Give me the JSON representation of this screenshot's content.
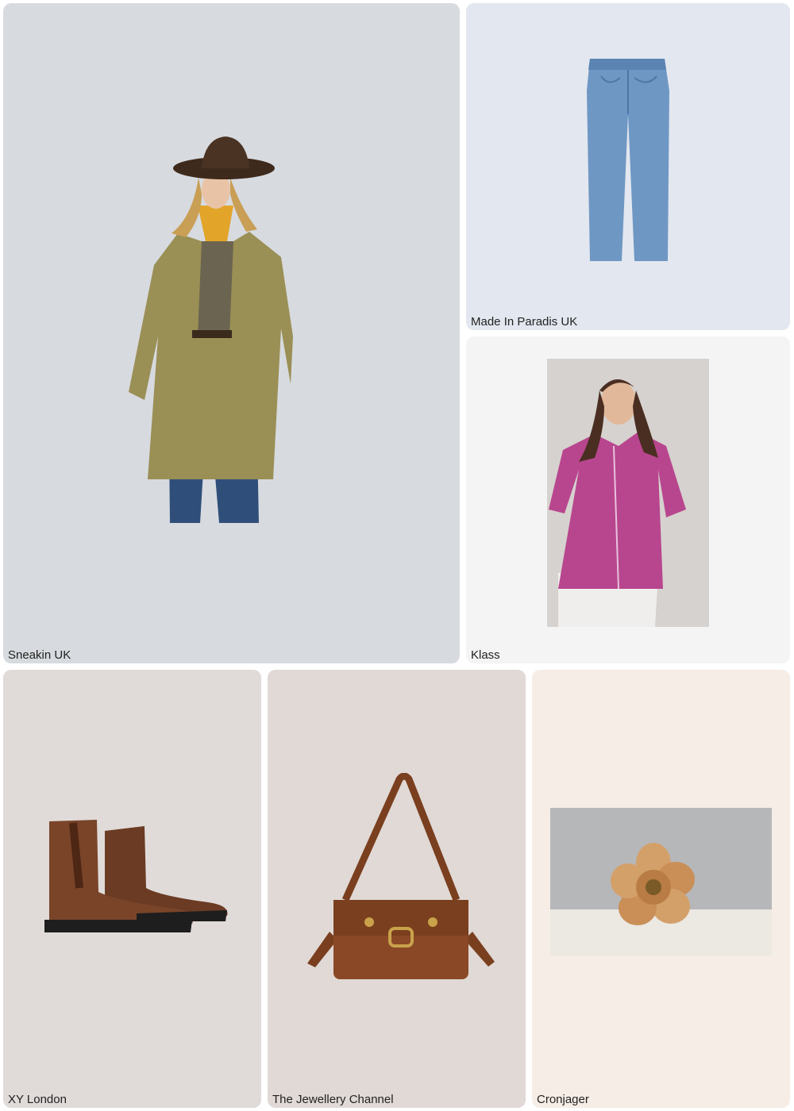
{
  "cards": [
    {
      "label": "Sneakin UK",
      "product": "khaki shirt jacket outfit with cowboy hat",
      "bg": "#d7dadf"
    },
    {
      "label": "Made In Paradis UK",
      "product": "light blue straight-leg jeans",
      "bg": "#e3e7ef"
    },
    {
      "label": "Klass",
      "product": "magenta button-up blouse",
      "bg": "#f4f4f5"
    },
    {
      "label": "XY London",
      "product": "brown leather chelsea boots",
      "bg": "#e0dbd9"
    },
    {
      "label": "The Jewellery Channel",
      "product": "brown leather shoulder bag",
      "bg": "#e0d9d6"
    },
    {
      "label": "Cronjager",
      "product": "tan flower brooch",
      "bg": "#f6ede6"
    }
  ]
}
